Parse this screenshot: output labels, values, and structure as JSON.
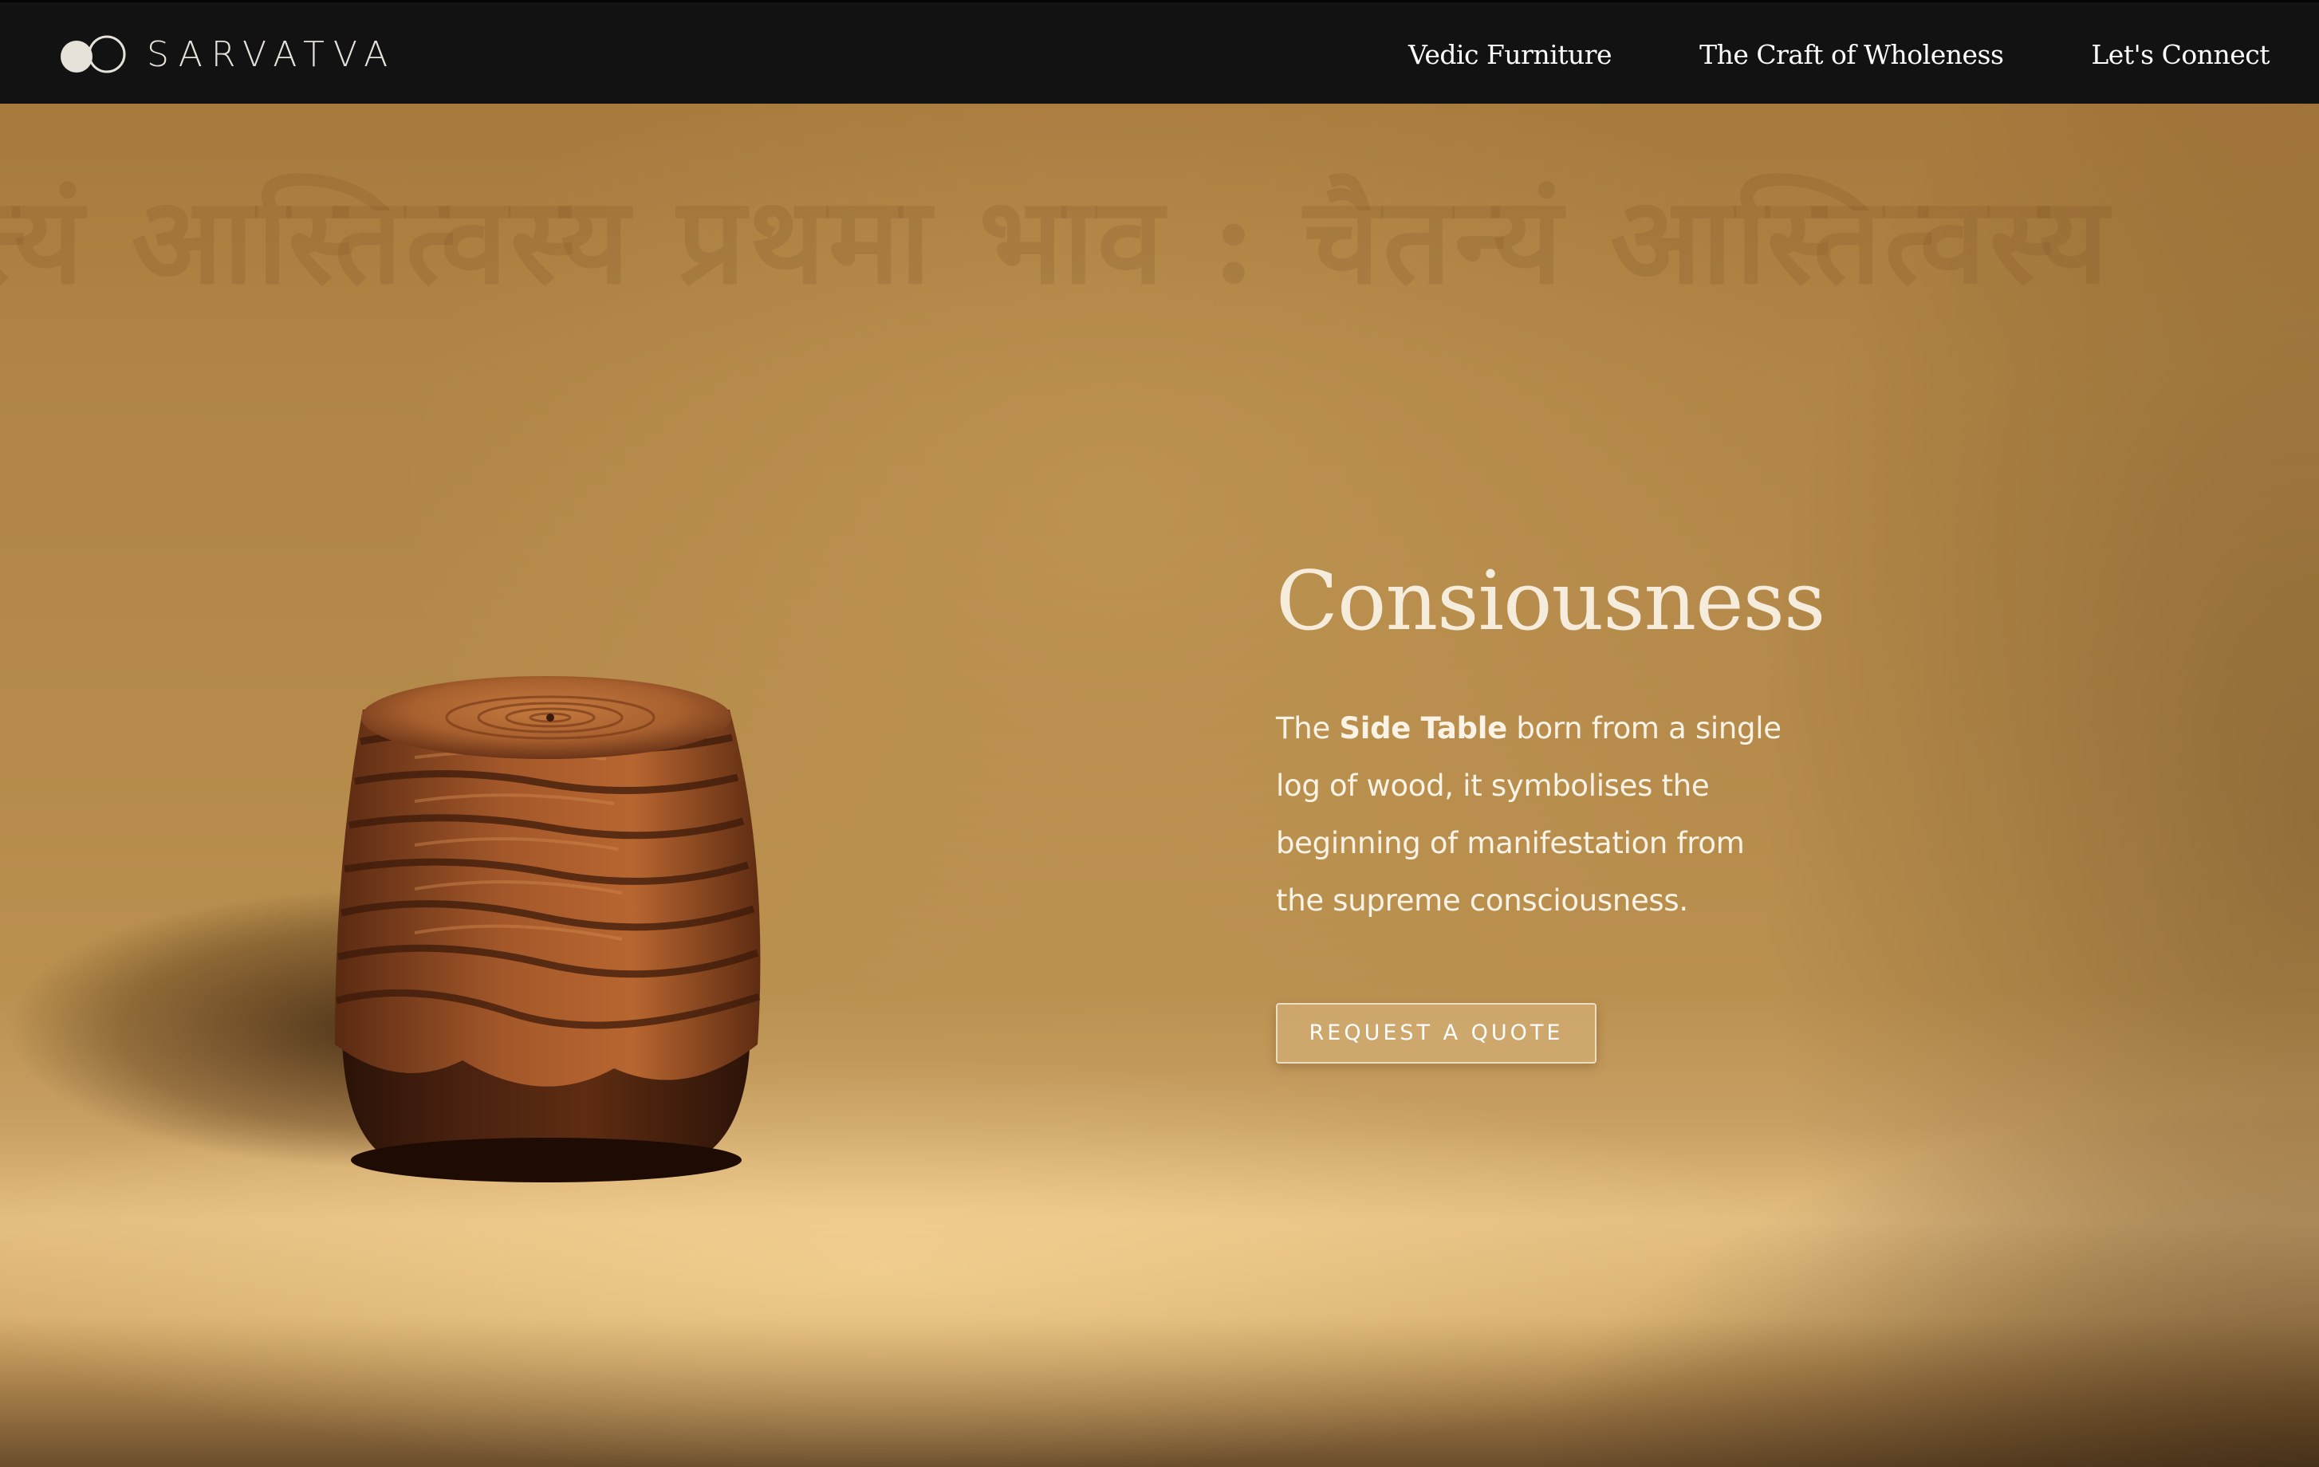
{
  "brand": {
    "name": "SARVATVA",
    "logo_icon": "two-circles-logo-icon"
  },
  "nav": {
    "items": [
      {
        "label": "Vedic Furniture"
      },
      {
        "label": "The Craft of Wholeness"
      },
      {
        "label": "Let's Connect"
      }
    ]
  },
  "hero": {
    "background_text": "त्यं आस्तित्वस्य प्रथमा भाव : चैतन्यं आस्तित्वस्य",
    "title": "Consiousness",
    "description": {
      "prefix": "The ",
      "highlight": "Side Table",
      "suffix": " born from a single log of wood, it symbolises the beginning of manifestation from the supreme consciousness."
    },
    "cta_label": "REQUEST A QUOTE",
    "product_image": "wooden-side-table-image"
  },
  "colors": {
    "navbar_bg": "#121212",
    "hero_bg": "#b58a4a",
    "title_color": "#f6ecdc",
    "button_bg": "#cea86e",
    "wood_dark": "#3a1a0c",
    "wood_light": "#a0562a"
  }
}
